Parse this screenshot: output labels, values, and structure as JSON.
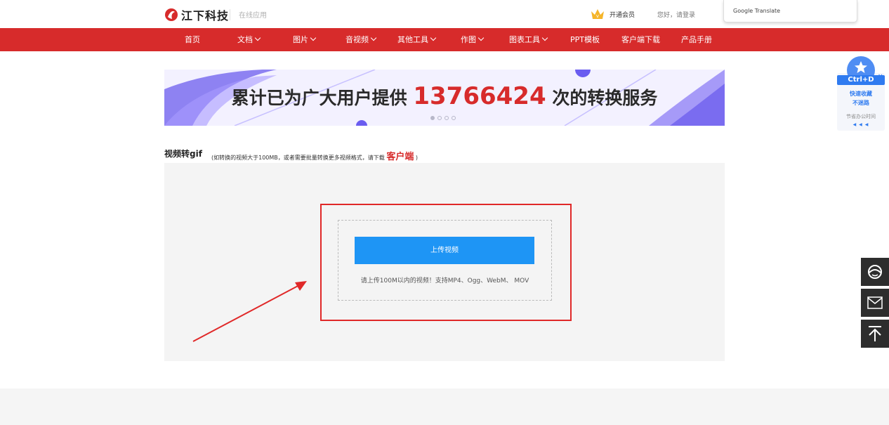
{
  "header": {
    "logo_text": "江下科技",
    "logo_sub": "在线应用",
    "vip_label": "开通会员",
    "login_text": "您好，请登录",
    "translate_label": "Google Translate"
  },
  "nav": {
    "items": [
      {
        "label": "首页",
        "dropdown": false
      },
      {
        "label": "文档",
        "dropdown": true
      },
      {
        "label": "图片",
        "dropdown": true
      },
      {
        "label": "音视频",
        "dropdown": true
      },
      {
        "label": "其他工具",
        "dropdown": true
      },
      {
        "label": "作图",
        "dropdown": true
      },
      {
        "label": "图表工具",
        "dropdown": true
      },
      {
        "label": "PPT模板",
        "dropdown": false
      },
      {
        "label": "客户端下载",
        "dropdown": false
      },
      {
        "label": "产品手册",
        "dropdown": false
      }
    ]
  },
  "banner": {
    "prefix": "累计已为广大用户提供",
    "count": "13766424",
    "suffix": "次的转换服务",
    "slide_count": 4,
    "active_slide": 0
  },
  "tool": {
    "title": "视频转gif",
    "note_prefix": "(如转换的视频大于100MB，或者需要批量转换更多视频格式，请下载",
    "client_link": "客户端",
    "note_suffix": ")"
  },
  "upload": {
    "button_label": "上传视频",
    "hint": "请上传100M以内的视频！支持MP4、Ogg、WebM、 MOV"
  },
  "bookmark": {
    "shortcut": "Ctrl+D",
    "close": "×",
    "line1": "快速收藏",
    "line2": "不迷路",
    "line3": "节省办公时间",
    "arrows": "◀ ◀ ◀"
  },
  "colors": {
    "nav_red": "#d72b2b",
    "upload_blue": "#1e95f5",
    "annotation_red": "#e02828"
  },
  "icons": {
    "side_buttons": [
      "headset-icon",
      "mail-icon",
      "back-to-top-icon"
    ]
  }
}
